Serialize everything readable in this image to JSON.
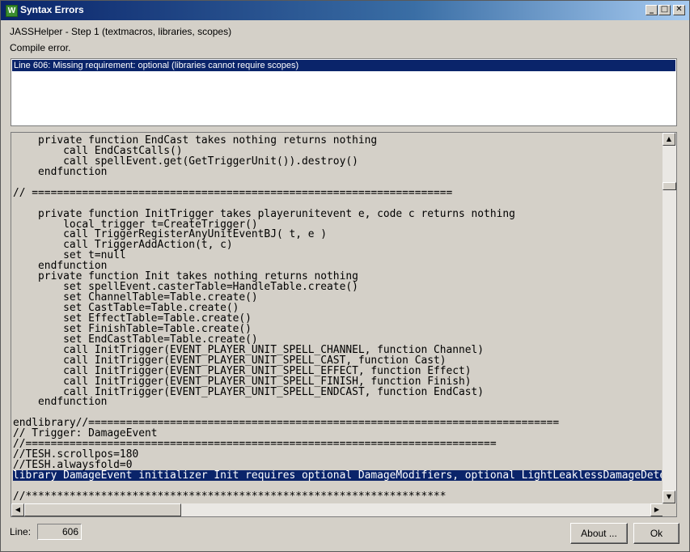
{
  "window": {
    "title": "Syntax Errors",
    "icon_letter": "W"
  },
  "title_buttons": {
    "minimize": "_",
    "maximize": "□",
    "close": "✕"
  },
  "header": {
    "step": "JASSHelper - Step 1 (textmacros, libraries, scopes)",
    "status": "Compile error."
  },
  "errors": [
    "Line 606: Missing requirement: optional (libraries cannot require scopes)"
  ],
  "code_lines": [
    "    private function EndCast takes nothing returns nothing",
    "        call EndCastCalls()",
    "        call spellEvent.get(GetTriggerUnit()).destroy()",
    "    endfunction",
    "",
    "// ===================================================================",
    "",
    "    private function InitTrigger takes playerunitevent e, code c returns nothing",
    "        local trigger t=CreateTrigger()",
    "        call TriggerRegisterAnyUnitEventBJ( t, e )",
    "        call TriggerAddAction(t, c)",
    "        set t=null",
    "    endfunction",
    "    private function Init takes nothing returns nothing",
    "        set spellEvent.casterTable=HandleTable.create()",
    "        set ChannelTable=Table.create()",
    "        set CastTable=Table.create()",
    "        set EffectTable=Table.create()",
    "        set FinishTable=Table.create()",
    "        set EndCastTable=Table.create()",
    "        call InitTrigger(EVENT_PLAYER_UNIT_SPELL_CHANNEL, function Channel)",
    "        call InitTrigger(EVENT_PLAYER_UNIT_SPELL_CAST, function Cast)",
    "        call InitTrigger(EVENT_PLAYER_UNIT_SPELL_EFFECT, function Effect)",
    "        call InitTrigger(EVENT_PLAYER_UNIT_SPELL_FINISH, function Finish)",
    "        call InitTrigger(EVENT_PLAYER_UNIT_SPELL_ENDCAST, function EndCast)",
    "    endfunction",
    "",
    "endlibrary//===========================================================================",
    "// Trigger: DamageEvent",
    "//===========================================================================",
    "//TESH.scrollpos=180",
    "//TESH.alwaysfold=0",
    "library DamageEvent initializer Init requires optional DamageModifiers, optional LightLeaklessDamageDetect",
    "",
    "//*******************************************************************"
  ],
  "selected_line_index": 32,
  "scrollbars": {
    "up": "▲",
    "down": "▼",
    "left": "◀",
    "right": "▶"
  },
  "footer": {
    "line_label": "Line:",
    "line_value": "606",
    "about_label": "About ...",
    "ok_label": "Ok"
  },
  "colors": {
    "selection": "#0a246a",
    "face": "#d4d0c8"
  }
}
